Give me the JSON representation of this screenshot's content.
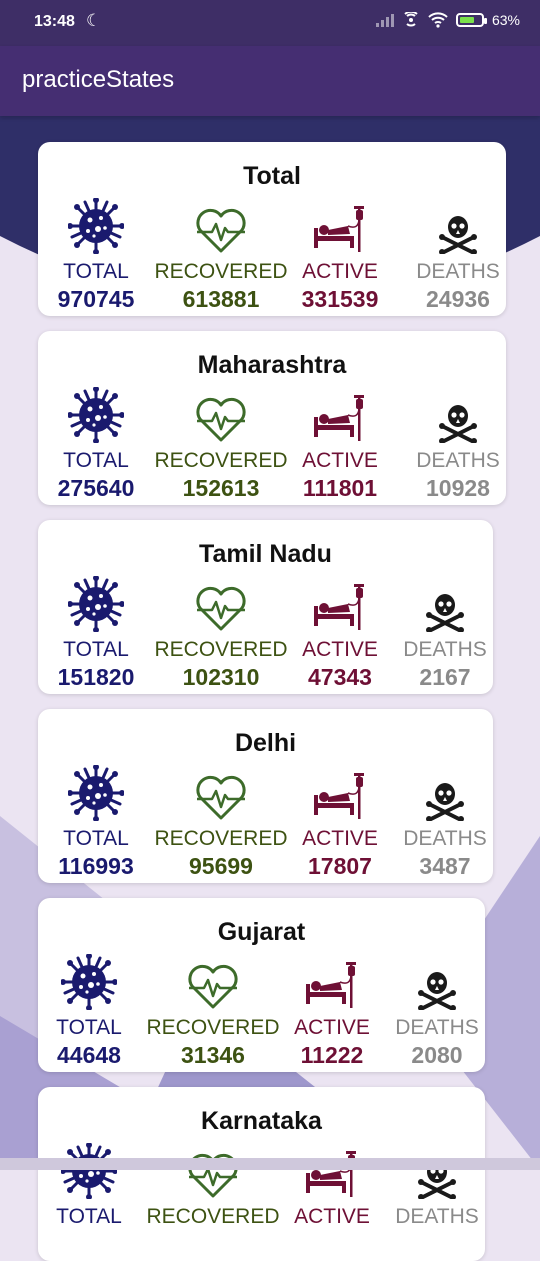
{
  "status_bar": {
    "time": "13:48",
    "battery": "63"
  },
  "app": {
    "title": "practiceStates"
  },
  "labels": {
    "total": "TOTAL",
    "recovered": "RECOVERED",
    "active": "ACTIVE",
    "deaths": "DEATHS"
  },
  "icons": {
    "total": "virus-icon",
    "recovered": "heart-pulse-icon",
    "active": "hospital-bed-icon",
    "deaths": "skull-crossbones-icon"
  },
  "colors": {
    "total": "#1a1a6e",
    "recovered": "#3d5212",
    "active": "#6e1035",
    "deaths": "#8a8a8a",
    "app_bar": "#452e72"
  },
  "cards": [
    {
      "name": "Total",
      "total": "970745",
      "recovered": "613881",
      "active": "331539",
      "deaths": "24936"
    },
    {
      "name": "Maharashtra",
      "total": "275640",
      "recovered": "152613",
      "active": "111801",
      "deaths": "10928"
    },
    {
      "name": "Tamil Nadu",
      "total": "151820",
      "recovered": "102310",
      "active": "47343",
      "deaths": "2167"
    },
    {
      "name": "Delhi",
      "total": "116993",
      "recovered": "95699",
      "active": "17807",
      "deaths": "3487"
    },
    {
      "name": "Gujarat",
      "total": "44648",
      "recovered": "31346",
      "active": "11222",
      "deaths": "2080"
    },
    {
      "name": "Karnataka",
      "total": "",
      "recovered": "",
      "active": "",
      "deaths": ""
    }
  ]
}
